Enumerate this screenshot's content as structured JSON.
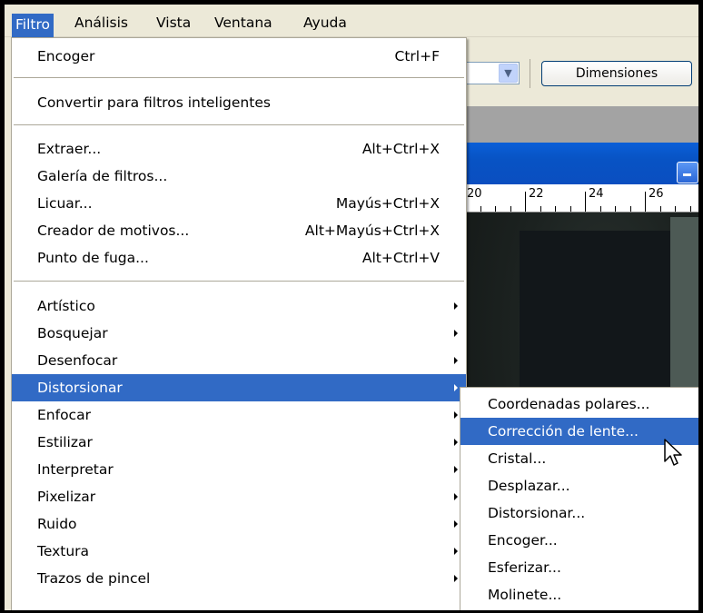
{
  "menubar": {
    "items": [
      {
        "label": "Filtro",
        "active": true
      },
      {
        "label": "Análisis",
        "active": false
      },
      {
        "label": "Vista",
        "active": false
      },
      {
        "label": "Ventana",
        "active": false
      },
      {
        "label": "Ayuda",
        "active": false
      }
    ]
  },
  "toolbar": {
    "combo_arrow_icon": "chevron-down-icon",
    "dimensions_label": "Dimensiones"
  },
  "ruler": {
    "labels": [
      "20",
      "22",
      "24",
      "26"
    ]
  },
  "filter_menu": {
    "groups": [
      [
        {
          "label": "Encoger",
          "shortcut": "Ctrl+F"
        }
      ],
      [
        {
          "label": "Convertir para filtros inteligentes",
          "shortcut": ""
        }
      ],
      [
        {
          "label": "Extraer...",
          "shortcut": "Alt+Ctrl+X"
        },
        {
          "label": "Galería de filtros...",
          "shortcut": ""
        },
        {
          "label": "Licuar...",
          "shortcut": "Mayús+Ctrl+X"
        },
        {
          "label": "Creador de motivos...",
          "shortcut": "Alt+Mayús+Ctrl+X"
        },
        {
          "label": "Punto de fuga...",
          "shortcut": "Alt+Ctrl+V"
        }
      ],
      [
        {
          "label": "Artístico",
          "submenu": true
        },
        {
          "label": "Bosquejar",
          "submenu": true
        },
        {
          "label": "Desenfocar",
          "submenu": true
        },
        {
          "label": "Distorsionar",
          "submenu": true,
          "selected": true
        },
        {
          "label": "Enfocar",
          "submenu": true
        },
        {
          "label": "Estilizar",
          "submenu": true
        },
        {
          "label": "Interpretar",
          "submenu": true
        },
        {
          "label": "Pixelizar",
          "submenu": true
        },
        {
          "label": "Ruido",
          "submenu": true
        },
        {
          "label": "Textura",
          "submenu": true
        },
        {
          "label": "Trazos de pincel",
          "submenu": true
        }
      ]
    ]
  },
  "distort_submenu": {
    "items": [
      {
        "label": "Coordenadas polares...",
        "selected": false
      },
      {
        "label": "Corrección de lente...",
        "selected": true
      },
      {
        "label": "Cristal...",
        "selected": false
      },
      {
        "label": "Desplazar...",
        "selected": false
      },
      {
        "label": "Distorsionar...",
        "selected": false
      },
      {
        "label": "Encoger...",
        "selected": false
      },
      {
        "label": "Esferizar...",
        "selected": false
      },
      {
        "label": "Molinete...",
        "selected": false
      }
    ]
  },
  "colors": {
    "highlight": "#316ac5",
    "menu_bg": "#ffffff",
    "chrome": "#ece9d8"
  }
}
